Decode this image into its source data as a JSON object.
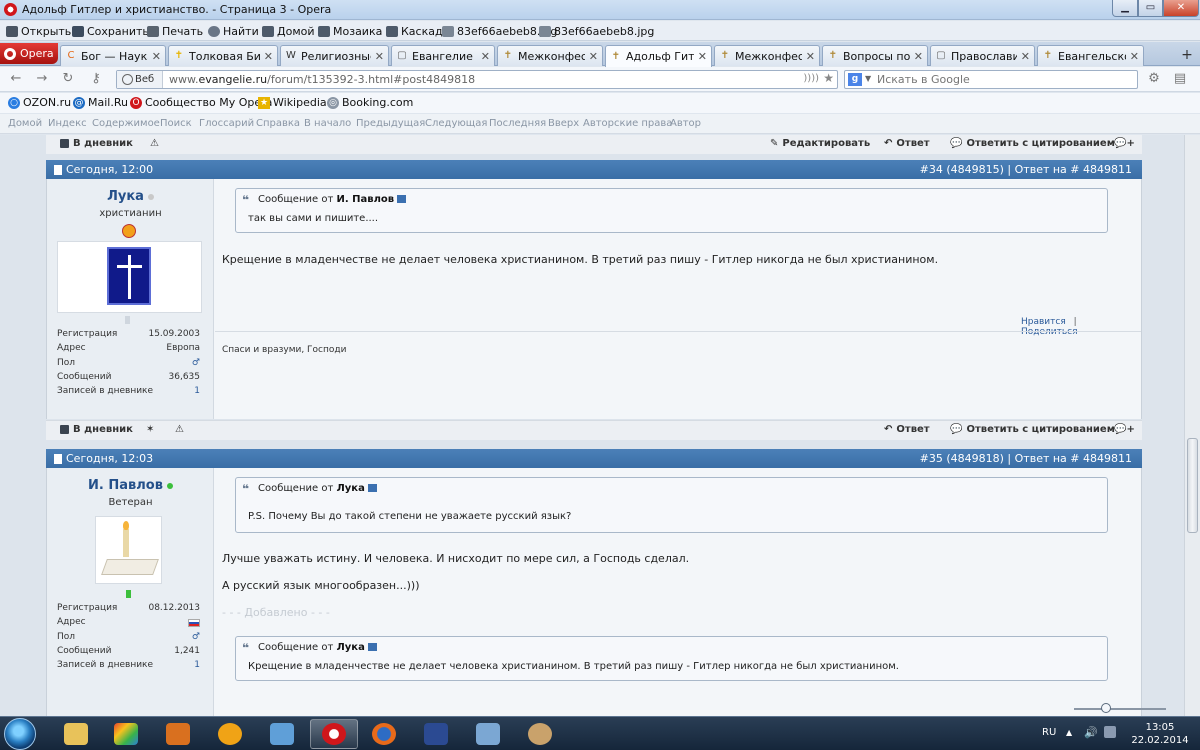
{
  "window": {
    "title": "Адольф Гитлер и христианство. - Страница 3 - Opera"
  },
  "toolbar": {
    "open": "Открыть",
    "save": "Сохранить",
    "print": "Печать",
    "find": "Найти",
    "home": "Домой",
    "mosaic": "Мозаика",
    "cascade": "Каскад",
    "file1": "83ef66aebeb8.jpg",
    "file2": "83ef66aebeb8.jpg"
  },
  "tabs": {
    "opera_menu": "Opera",
    "items": [
      {
        "label": "Бог — Наука",
        "icon": "C",
        "color": "#e46a1a"
      },
      {
        "label": "Толковая Биб…",
        "icon": "✝",
        "color": "#e8b400"
      },
      {
        "label": "Религиозные …",
        "icon": "W",
        "color": "#333333"
      },
      {
        "label": "Евангелие от …",
        "icon": "▢",
        "color": "#666666"
      },
      {
        "label": "Межконфесс…",
        "icon": "✝",
        "color": "#b08a3a"
      },
      {
        "label": "Адольф Гитле…",
        "icon": "✝",
        "color": "#b08a3a"
      },
      {
        "label": "Межконфесс…",
        "icon": "✝",
        "color": "#b08a3a"
      },
      {
        "label": "Вопросы по Б…",
        "icon": "✝",
        "color": "#b08a3a"
      },
      {
        "label": "Православие",
        "icon": "▢",
        "color": "#666666"
      },
      {
        "label": "Евангельское …",
        "icon": "✝",
        "color": "#b08a3a"
      }
    ],
    "active_index": 5
  },
  "address": {
    "web_label": "Веб",
    "url_prefix": "www.",
    "url_domain": "evangelie.ru",
    "url_path": "/forum/t135392-3.html#post4849818",
    "search_placeholder": "Искать в Google"
  },
  "bookmarks": [
    "OZON.ru",
    "Mail.Ru",
    "Сообщество My Opera",
    "Wikipedia",
    "Booking.com"
  ],
  "sitenav": [
    "Домой",
    "Индекс",
    "Содержимое",
    "Поиск",
    "Глоссарий",
    "Справка",
    "В начало",
    "Предыдущая",
    "Следующая",
    "Последняя",
    "Вверх",
    "Авторские права",
    "Автор"
  ],
  "top_actions": {
    "diary": "В дневник",
    "edit": "Редактировать",
    "reply": "Ответ",
    "quote": "Ответить с цитированием"
  },
  "posts": [
    {
      "time": "Сегодня, 12:00",
      "ref": "#34 (4849815) | Ответ на # 4849811",
      "username": "Лука",
      "online": false,
      "usertitle": "христианин",
      "stats": [
        {
          "k": "Регистрация",
          "v": "15.09.2003"
        },
        {
          "k": "Адрес",
          "v": "Европа"
        },
        {
          "k": "Пол",
          "v": "♂"
        },
        {
          "k": "Сообщений",
          "v": "36,635"
        },
        {
          "k": "Записей в дневнике",
          "v": "1"
        }
      ],
      "quote_prefix": "Сообщение от",
      "quote_author": "И. Павлов",
      "quote_text": "так вы сами и пишите....",
      "message": "Крещение в младенчестве не делает человека христианином. В третий раз пишу - Гитлер никогда не был христианином.",
      "like": "Нравится",
      "share": "Поделиться",
      "signature": "Спаси и вразуми, Господи",
      "actions": {
        "diary": "В дневник",
        "reply": "Ответ",
        "quote": "Ответить с цитированием"
      }
    },
    {
      "time": "Сегодня, 12:03",
      "ref": "#35 (4849818) | Ответ на # 4849811",
      "username": "И. Павлов",
      "online": true,
      "usertitle": "Ветеран",
      "stats": [
        {
          "k": "Регистрация",
          "v": "08.12.2013"
        },
        {
          "k": "Адрес",
          "v": ""
        },
        {
          "k": "Пол",
          "v": "♂"
        },
        {
          "k": "Сообщений",
          "v": "1,241"
        },
        {
          "k": "Записей в дневнике",
          "v": "1"
        }
      ],
      "quote_prefix": "Сообщение от",
      "quote_author": "Лука",
      "quote_text": "P.S. Почему Вы до такой степени не уважаете русский язык?",
      "message1": "Лучше уважать истину. И человека. И нисходит по мере сил, а Господь сделал.",
      "message2": "А русский язык многообразен...)))",
      "added": "- - - Добавлено - - -",
      "quote2_prefix": "Сообщение от",
      "quote2_author": "Лука",
      "quote2_text": "Крещение в младенчестве не делает человека христианином. В третий раз пишу - Гитлер никогда не был христианином."
    }
  ],
  "tray": {
    "lang": "RU",
    "time": "13:05",
    "date": "22.02.2014"
  },
  "colors": {
    "post_header": "#3f74ad",
    "link": "#2a5a9a",
    "online": "#3cbf3c",
    "offline": "#bbbbbb"
  }
}
